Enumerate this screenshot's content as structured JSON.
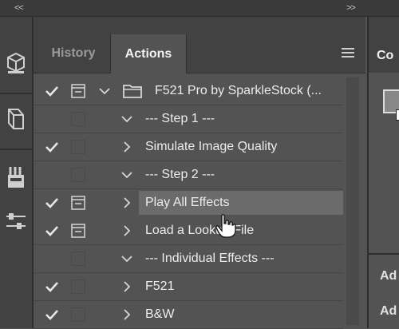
{
  "top": {
    "collapse_left": "<<",
    "collapse_right": ">>"
  },
  "tools": [
    "3d-cube-icon",
    "3d-shape-icon",
    "brushes-icon",
    "sliders-icon"
  ],
  "tabs": {
    "history": "History",
    "actions": "Actions"
  },
  "actions": [
    {
      "label": "F521 Pro by SparkleStock (...",
      "checked": true,
      "dialog": true,
      "expanded": true,
      "type": "set"
    },
    {
      "label": "--- Step 1 ---",
      "checked": false,
      "dialog": false,
      "expanded": true,
      "type": "action"
    },
    {
      "label": "Simulate Image Quality",
      "checked": true,
      "dialog": false,
      "expanded": false,
      "type": "action"
    },
    {
      "label": "--- Step 2 ---",
      "checked": false,
      "dialog": false,
      "expanded": true,
      "type": "action"
    },
    {
      "label": "Play All Effects",
      "checked": true,
      "dialog": true,
      "expanded": false,
      "type": "action",
      "highlighted": true
    },
    {
      "label": "Load a Lookup File",
      "checked": true,
      "dialog": true,
      "expanded": false,
      "type": "action"
    },
    {
      "label": "--- Individual Effects ---",
      "checked": false,
      "dialog": false,
      "expanded": true,
      "type": "action"
    },
    {
      "label": "F521",
      "checked": true,
      "dialog": false,
      "expanded": false,
      "type": "action"
    },
    {
      "label": "B&W",
      "checked": true,
      "dialog": false,
      "expanded": false,
      "type": "action"
    }
  ],
  "right_panel": {
    "tab": "Co",
    "label1": "Ad",
    "label2": "Ad"
  }
}
